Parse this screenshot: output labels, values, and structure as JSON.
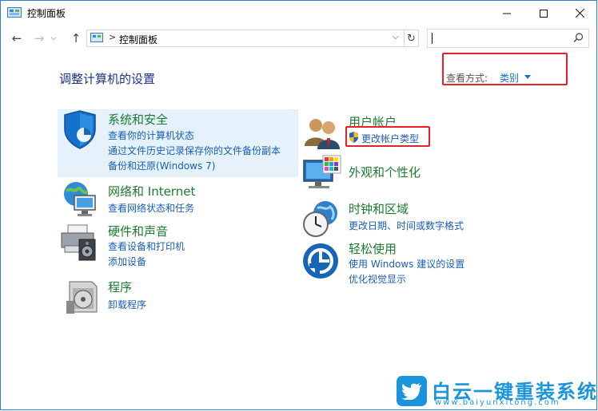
{
  "window": {
    "title": "控制面板"
  },
  "navigation": {
    "back": "←",
    "forward": "→",
    "up": "↑",
    "breadcrumb_separator": ">",
    "address_text": "控制面板",
    "dropdown": "⌵",
    "refresh": "↻",
    "search_placeholder": ""
  },
  "page": {
    "heading": "调整计算机的设置",
    "view_by_label": "查看方式:",
    "view_by_value": "类别"
  },
  "categories": [
    {
      "title": "系统和安全",
      "icon": "shield-icon",
      "links": [
        "查看你的计算机状态",
        "通过文件历史记录保存你的文件备份副本",
        "备份和还原(Windows 7)"
      ]
    },
    {
      "title": "网络和 Internet",
      "icon": "network-globe-icon",
      "links": [
        "查看网络状态和任务"
      ]
    },
    {
      "title": "硬件和声音",
      "icon": "printer-speaker-icon",
      "links": [
        "查看设备和打印机",
        "添加设备"
      ]
    },
    {
      "title": "程序",
      "icon": "programs-disc-icon",
      "links": [
        "卸载程序"
      ]
    },
    {
      "title": "用户帐户",
      "icon": "users-icon",
      "links": [
        "更改帐户类型"
      ]
    },
    {
      "title": "外观和个性化",
      "icon": "monitor-palette-icon",
      "links": []
    },
    {
      "title": "时钟和区域",
      "icon": "clock-globe-icon",
      "links": [
        "更改日期、时间或数字格式"
      ]
    },
    {
      "title": "轻松使用",
      "icon": "ease-of-access-icon",
      "links": [
        "使用 Windows 建议的设置",
        "优化视觉显示"
      ]
    }
  ],
  "watermark": {
    "name": "白云一键重装系统",
    "url": "www.baiyunxitong.com"
  },
  "colors": {
    "category_title": "#1d7a30",
    "link": "#1a5fb4",
    "heading": "#1e3287",
    "highlight_bg": "#e5f1fb",
    "annotation_red": "#e8202a",
    "watermark_blue": "#1a95dc"
  }
}
